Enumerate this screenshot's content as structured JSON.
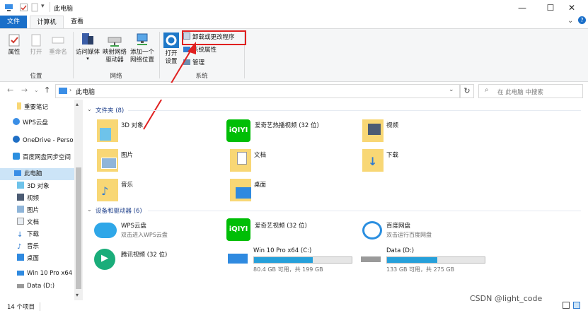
{
  "window": {
    "title": "此电脑",
    "min_glyph": "—",
    "max_glyph": "☐",
    "close_glyph": "✕"
  },
  "ribbon_tabs": {
    "file": "文件",
    "computer": "计算机",
    "view": "查看"
  },
  "ribbon": {
    "location": {
      "properties": "属性",
      "open": "打开",
      "rename": "重命名",
      "group": "位置"
    },
    "network": {
      "access_media": "访问媒体",
      "map_drive_1": "映射网络",
      "map_drive_2": "驱动器",
      "add_location_1": "添加一个",
      "add_location_2": "网络位置",
      "group": "网络"
    },
    "system": {
      "open_settings_1": "打开",
      "open_settings_2": "设置",
      "uninstall": "卸载或更改程序",
      "sys_props": "系统属性",
      "manage": "管理",
      "group": "系统"
    }
  },
  "address": {
    "path": "此电脑",
    "search_placeholder": "在 此电脑 中搜索"
  },
  "nav_pane": {
    "items": [
      {
        "label": "重要笔记"
      },
      {
        "label": "WPS云盘"
      },
      {
        "label": "OneDrive - Perso"
      },
      {
        "label": "百度网盘同步空间"
      },
      {
        "label": "此电脑"
      },
      {
        "label": "3D 对象"
      },
      {
        "label": "视频"
      },
      {
        "label": "图片"
      },
      {
        "label": "文档"
      },
      {
        "label": "下载"
      },
      {
        "label": "音乐"
      },
      {
        "label": "桌面"
      },
      {
        "label": "Win 10 Pro x64"
      },
      {
        "label": "Data (D:)"
      }
    ]
  },
  "folders_section": {
    "header": "文件夹 (8)",
    "items": [
      {
        "name": "3D 对象"
      },
      {
        "name": "爱奇艺热播视频 (32 位)"
      },
      {
        "name": "视频"
      },
      {
        "name": "图片"
      },
      {
        "name": "文档"
      },
      {
        "name": "下载"
      },
      {
        "name": "音乐"
      },
      {
        "name": "桌面"
      }
    ]
  },
  "devices_section": {
    "header": "设备和驱动器 (6)",
    "wps": {
      "name": "WPS云盘",
      "sub": "双击进入WPS云盘"
    },
    "iqiyi": {
      "name": "爱奇艺视频 (32 位)"
    },
    "baidu": {
      "name": "百度网盘",
      "sub": "双击运行百度网盘"
    },
    "tencent": {
      "name": "腾讯视频 (32 位)"
    },
    "c_drive": {
      "name": "Win 10 Pro x64 (C:)",
      "sub": "80.4 GB 可用，共 199 GB",
      "used_fraction": 0.6
    },
    "d_drive": {
      "name": "Data (D:)",
      "sub": "133 GB 可用，共 275 GB",
      "used_fraction": 0.516
    }
  },
  "status": {
    "count": "14 个项目"
  },
  "watermark": "CSDN @light_code",
  "colors": {
    "accent": "#1a6fc9",
    "folder": "#f8d775",
    "highlight": "#e02020",
    "iqiyi": "#00be06",
    "drive_fill": "#26a0da"
  }
}
